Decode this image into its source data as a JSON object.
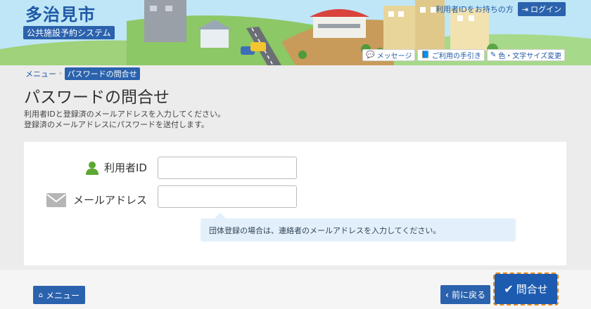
{
  "header": {
    "site_title": "多治見市",
    "site_subtitle": "公共施設予約システム",
    "login_prompt": "利用者IDをお持ちの方",
    "login_button": "ログイン",
    "util_links": [
      {
        "label": "メッセージ",
        "icon": "speech-bubble-icon"
      },
      {
        "label": "ご利用の手引き",
        "icon": "book-icon"
      },
      {
        "label": "色・文字サイズ変更",
        "icon": "brush-icon"
      }
    ]
  },
  "breadcrumb": {
    "items": [
      "メニュー",
      "パスワードの問合せ"
    ]
  },
  "page": {
    "title": "パスワードの問合せ",
    "description_lines": [
      "利用者IDと登録済のメールアドレスを入力してください。",
      "登録済のメールアドレスにパスワードを送付します。"
    ]
  },
  "form": {
    "user_id_label": "利用者ID",
    "user_id_value": "",
    "email_label": "メールアドレス",
    "email_value": "",
    "note": "団体登録の場合は、連絡者のメールアドレスを入力してください。"
  },
  "footer": {
    "menu_button": "メニュー",
    "back_button": "前に戻る",
    "submit_button": "問合せ"
  },
  "colors": {
    "primary": "#2b62ad",
    "header_sky": "#bfe6f7",
    "focus_outline": "#e08a1e",
    "note_bg": "#e3f0fc"
  }
}
